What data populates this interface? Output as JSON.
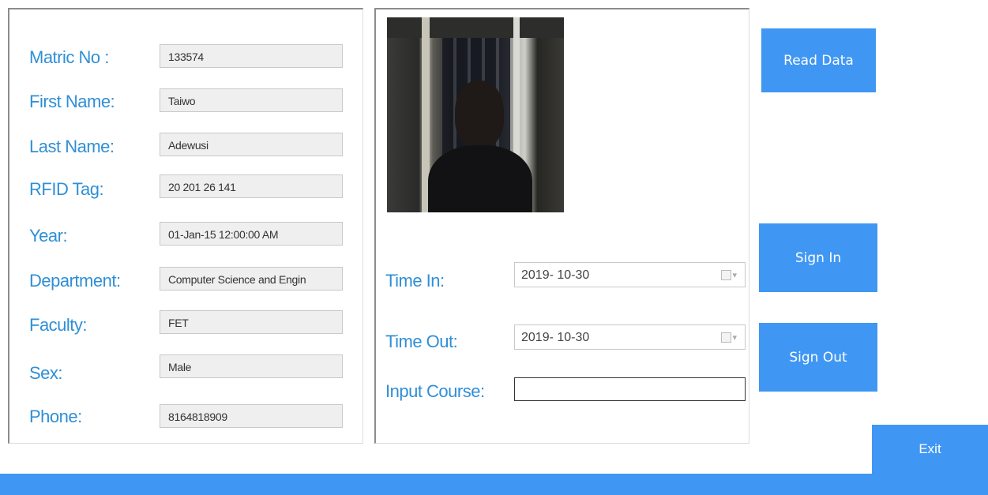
{
  "student": {
    "fields": [
      {
        "label": "Matric No :",
        "value": "133574"
      },
      {
        "label": "First Name:",
        "value": "Taiwo"
      },
      {
        "label": "Last Name:",
        "value": "Adewusi"
      },
      {
        "label": "RFID Tag:",
        "value": " 20 201 26 141"
      },
      {
        "label": "Year:",
        "value": "01-Jan-15 12:00:00 AM"
      },
      {
        "label": "Department:",
        "value": "Computer Science and Engin"
      },
      {
        "label": "Faculty:",
        "value": "FET"
      },
      {
        "label": "Sex:",
        "value": "Male"
      },
      {
        "label": "Phone:",
        "value": "8164818909"
      }
    ]
  },
  "attendance": {
    "time_in_label": "Time In:",
    "time_in_value": "2019- 10-30",
    "time_out_label": "Time Out:",
    "time_out_value": "2019- 10-30",
    "course_label": "Input Course:",
    "course_value": ""
  },
  "buttons": {
    "read_data": "Read Data",
    "sign_in": "Sign In",
    "sign_out": "Sign Out",
    "exit": "Exit"
  },
  "colors": {
    "accent": "#3f97f3",
    "label": "#2f8fd6"
  },
  "icons": {
    "calendar": "calendar-dropdown-icon"
  }
}
